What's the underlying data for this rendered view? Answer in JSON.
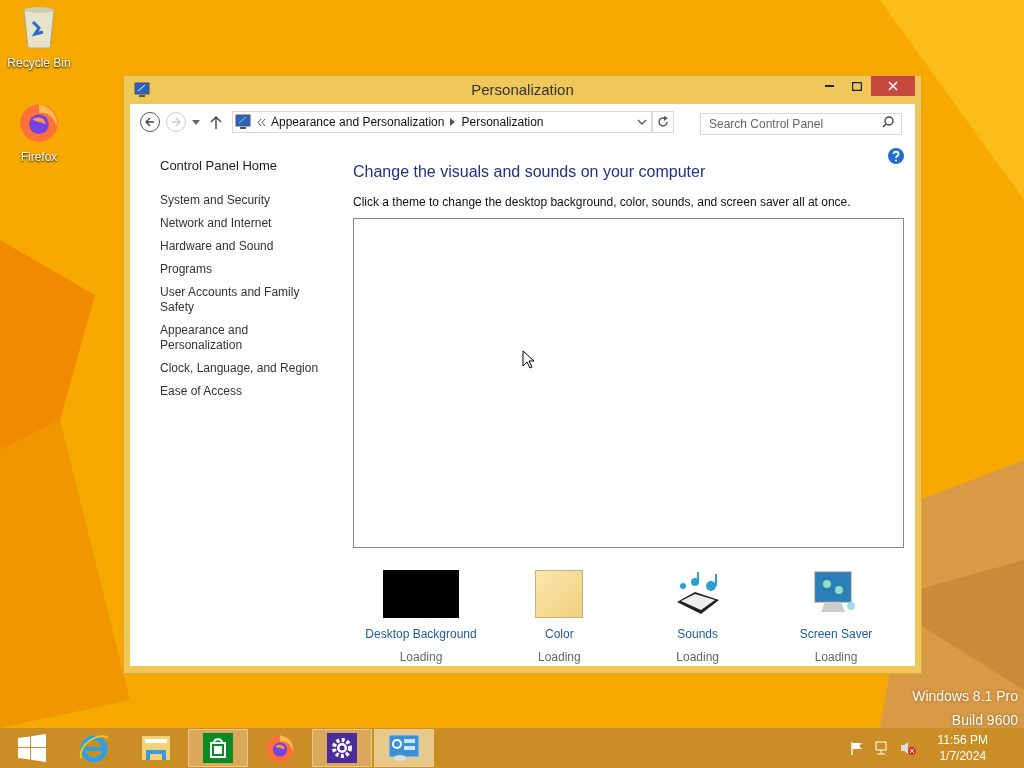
{
  "desktop_icons": [
    {
      "kind": "recycle-bin",
      "label": "Recycle Bin"
    },
    {
      "kind": "firefox",
      "label": "Firefox"
    }
  ],
  "window": {
    "title": "Personalization"
  },
  "nav": {
    "breadcrumb": [
      "Appearance and Personalization",
      "Personalization"
    ],
    "search": {
      "placeholder": "Search Control Panel"
    },
    "forward_disabled": true
  },
  "sidebar": {
    "home": "Control Panel Home",
    "items": [
      "System and Security",
      "Network and Internet",
      "Hardware and Sound",
      "Programs",
      "User Accounts and Family Safety",
      "Appearance and Personalization",
      "Clock, Language, and Region",
      "Ease of Access"
    ]
  },
  "main": {
    "heading": "Change the visuals and sounds on your computer",
    "description": "Click a theme to change the desktop background, color, sounds, and screen saver all at once.",
    "settings": [
      {
        "kind": "background",
        "label": "Desktop Background",
        "status": "Loading"
      },
      {
        "kind": "color",
        "label": "Color",
        "status": "Loading"
      },
      {
        "kind": "sounds",
        "label": "Sounds",
        "status": "Loading"
      },
      {
        "kind": "screensaver",
        "label": "Screen Saver",
        "status": "Loading"
      }
    ]
  },
  "watermark": [
    "Windows 8.1 Pro",
    "Build 9600"
  ],
  "taskbar": {
    "items": [
      {
        "kind": "start",
        "running": false,
        "selected": false
      },
      {
        "kind": "ie",
        "running": false,
        "selected": false
      },
      {
        "kind": "explorer",
        "running": false,
        "selected": false
      },
      {
        "kind": "store",
        "running": true,
        "selected": false
      },
      {
        "kind": "firefox",
        "running": false,
        "selected": false
      },
      {
        "kind": "settings",
        "running": true,
        "selected": false
      },
      {
        "kind": "control-panel",
        "running": true,
        "selected": true
      }
    ],
    "time": "11:56 PM",
    "date": "1/7/2024"
  }
}
